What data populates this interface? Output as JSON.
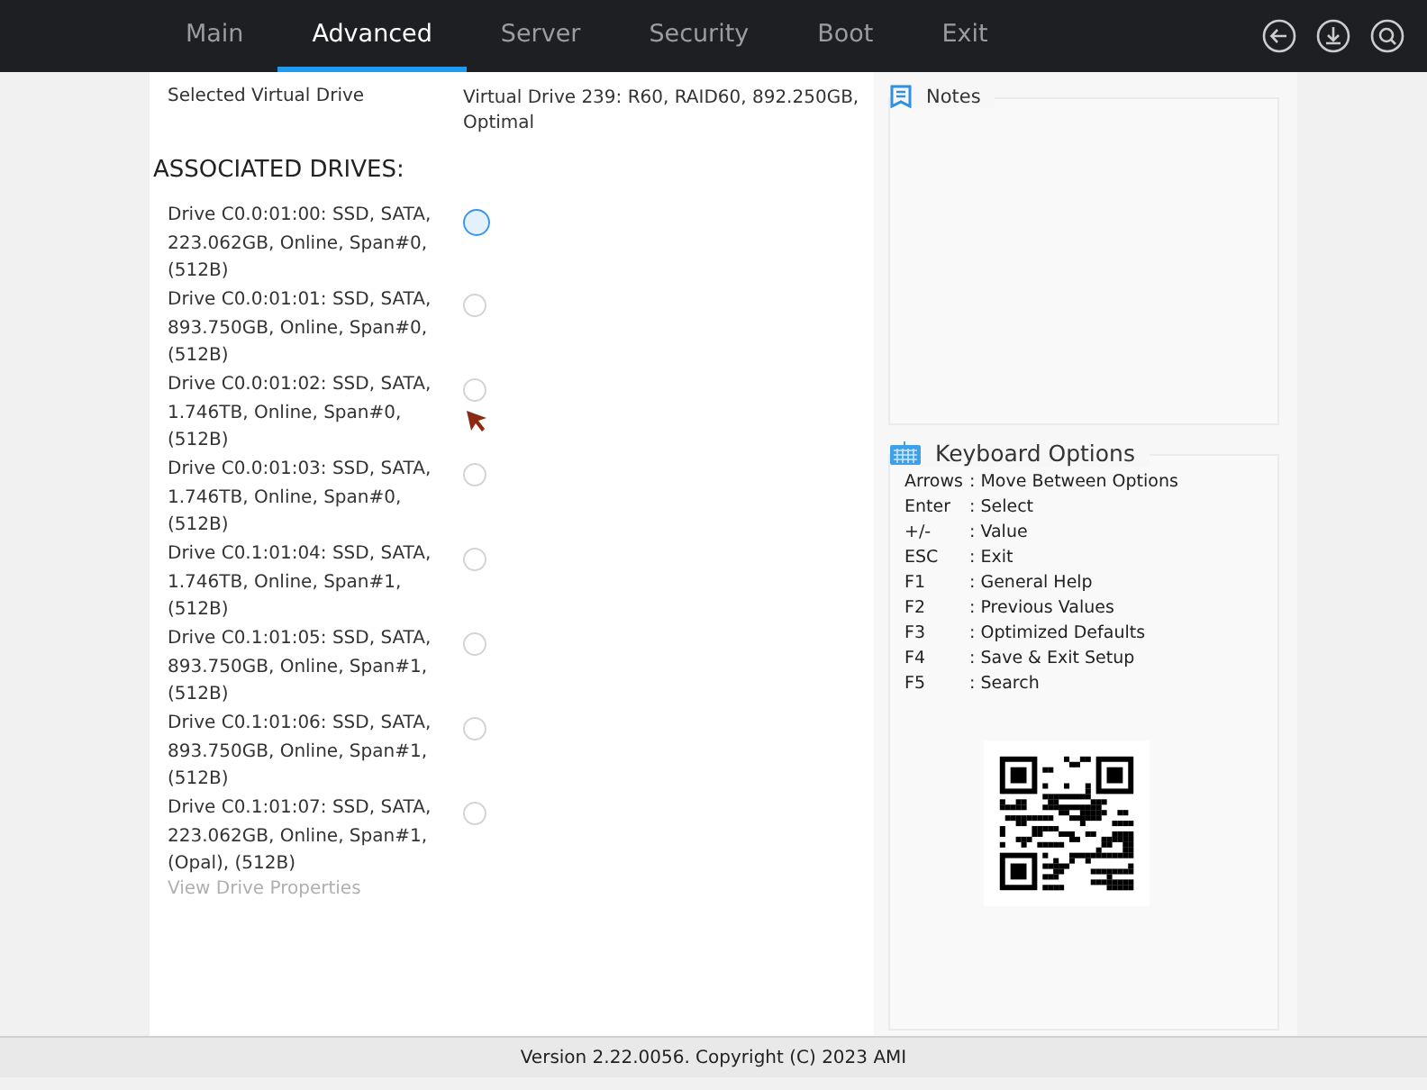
{
  "tabs": [
    {
      "label": "Main",
      "selected": false
    },
    {
      "label": "Advanced",
      "selected": true
    },
    {
      "label": "Server",
      "selected": false
    },
    {
      "label": "Security",
      "selected": false
    },
    {
      "label": "Boot",
      "selected": false
    },
    {
      "label": "Exit",
      "selected": false
    }
  ],
  "selected_virtual_drive": {
    "label": "Selected Virtual Drive",
    "value": "Virtual Drive 239: R60, RAID60, 892.250GB, Optimal"
  },
  "section_title": "ASSOCIATED DRIVES:",
  "drives": [
    {
      "label": "Drive C0.0:01:00: SSD, SATA, 223.062GB, Online, Span#0, (512B)",
      "focused": true
    },
    {
      "label": "Drive C0.0:01:01: SSD, SATA, 893.750GB, Online, Span#0, (512B)",
      "focused": false
    },
    {
      "label": "Drive C0.0:01:02: SSD, SATA, 1.746TB, Online, Span#0, (512B)",
      "focused": false
    },
    {
      "label": "Drive C0.0:01:03: SSD, SATA, 1.746TB, Online, Span#0, (512B)",
      "focused": false
    },
    {
      "label": "Drive C0.1:01:04: SSD, SATA, 1.746TB, Online, Span#1, (512B)",
      "focused": false
    },
    {
      "label": "Drive C0.1:01:05: SSD, SATA, 893.750GB, Online, Span#1, (512B)",
      "focused": false
    },
    {
      "label": "Drive C0.1:01:06: SSD, SATA, 893.750GB, Online, Span#1, (512B)",
      "focused": false
    },
    {
      "label": "Drive C0.1:01:07: SSD, SATA, 223.062GB, Online, Span#1, (Opal), (512B)",
      "focused": false
    }
  ],
  "view_link": {
    "label": "View Drive Properties",
    "disabled": true
  },
  "notes": {
    "title": "Notes"
  },
  "keyboard_options": {
    "title": "Keyboard Options",
    "items": [
      {
        "key": "Arrows",
        "action": ": Move Between Options"
      },
      {
        "key": "Enter",
        "action": ": Select"
      },
      {
        "key": "+/-",
        "action": ": Value"
      },
      {
        "key": "ESC",
        "action": ": Exit"
      },
      {
        "key": "F1",
        "action": ": General Help"
      },
      {
        "key": "F2",
        "action": ": Previous Values"
      },
      {
        "key": "F3",
        "action": ": Optimized Defaults"
      },
      {
        "key": "F4",
        "action": ": Save & Exit Setup"
      },
      {
        "key": "F5",
        "action": ": Search"
      }
    ]
  },
  "status_bar": "Version 2.22.0056. Copyright (C) 2023 AMI"
}
